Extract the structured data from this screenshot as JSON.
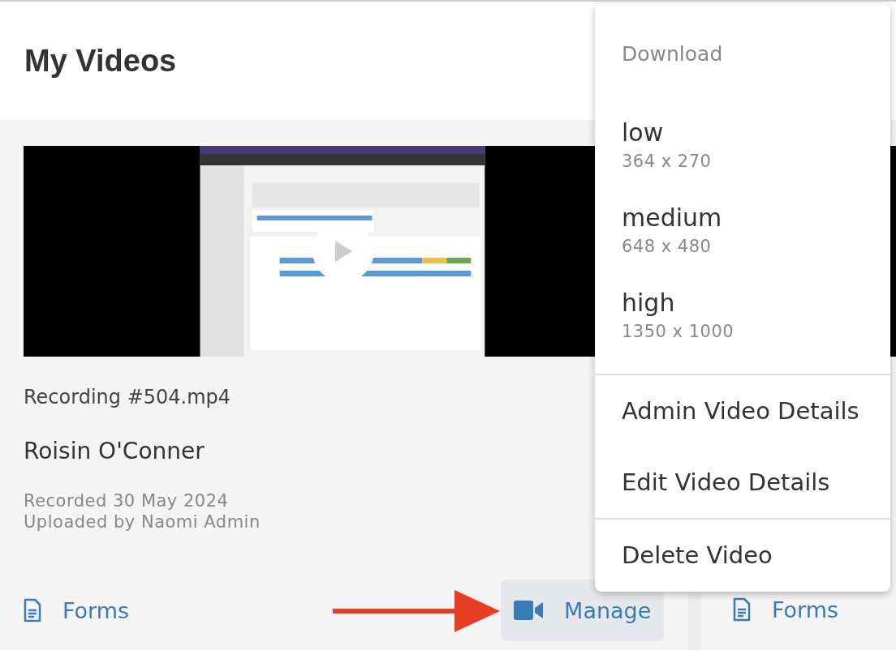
{
  "page_title": "My Videos",
  "cards": [
    {
      "video": {
        "kind": "picture"
      },
      "file_name": "Recording #504.mp4",
      "person": "Roisin O'Conner",
      "recorded": "Recorded 30 May 2024",
      "uploaded": "Uploaded by Naomi Admin",
      "actions": [
        {
          "kind": "forms",
          "label": "Forms",
          "selected": false
        },
        {
          "kind": "manage",
          "label": "Manage",
          "selected": true
        }
      ]
    },
    {
      "video": {
        "kind": "blank"
      },
      "actions": [
        {
          "kind": "forms",
          "label": "Forms",
          "selected": false
        }
      ]
    }
  ],
  "menu": {
    "heading": "Download",
    "qualities": [
      {
        "label": "low",
        "size": "364 x 270"
      },
      {
        "label": "medium",
        "size": "648 x 480"
      },
      {
        "label": "high",
        "size": "1350 x 1000"
      }
    ],
    "groups": [
      [
        "Admin Video Details",
        "Edit Video Details"
      ],
      [
        "Delete Video"
      ]
    ]
  }
}
